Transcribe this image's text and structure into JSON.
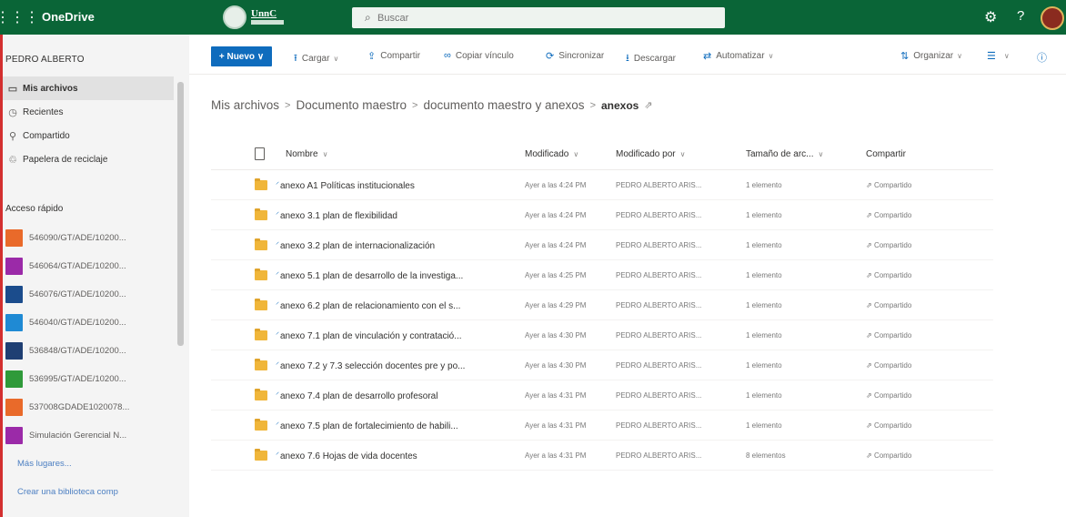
{
  "suite": {
    "app_name": "OneDrive",
    "org_logo_text": "UnnC",
    "search_placeholder": "Buscar"
  },
  "nav": {
    "user": "PEDRO ALBERTO",
    "items": [
      {
        "label": "Mis archivos",
        "icon": "folder-icon",
        "selected": true
      },
      {
        "label": "Recientes",
        "icon": "clock-icon",
        "selected": false
      },
      {
        "label": "Compartido",
        "icon": "people-icon",
        "selected": false
      },
      {
        "label": "Papelera de reciclaje",
        "icon": "recycle-bin-icon",
        "selected": false
      }
    ],
    "quick_access_title": "Acceso rápido",
    "quick_access": [
      {
        "label": "546090/GT/ADE/10200...",
        "color": "#e96a2a"
      },
      {
        "label": "546064/GT/ADE/10200...",
        "color": "#9b2aa8"
      },
      {
        "label": "546076/GT/ADE/10200...",
        "color": "#1b4c8c"
      },
      {
        "label": "546040/GT/ADE/10200...",
        "color": "#1f8ad4"
      },
      {
        "label": "536848/GT/ADE/10200...",
        "color": "#1f3f73"
      },
      {
        "label": "536995/GT/ADE/10200...",
        "color": "#2f9a3a"
      },
      {
        "label": "537008GDADE1020078...",
        "color": "#e96a2a"
      },
      {
        "label": "Simulación Gerencial N...",
        "color": "#9b2aa8"
      }
    ],
    "more_places": "Más lugares...",
    "create_library": "Crear una biblioteca comp"
  },
  "commands": {
    "new": "+ Nuevo ∨",
    "upload": "Cargar",
    "share": "Compartir",
    "copy_link": "Copiar vínculo",
    "sync": "Sincronizar",
    "download": "Descargar",
    "automate": "Automatizar",
    "organize": "Organizar"
  },
  "breadcrumb": {
    "parts": [
      "Mis archivos",
      "Documento maestro",
      "documento maestro y anexos"
    ],
    "current": "anexos"
  },
  "columns": {
    "name": "Nombre",
    "modified": "Modificado",
    "modified_by": "Modificado por",
    "size": "Tamaño de arc...",
    "sharing": "Compartir"
  },
  "files": [
    {
      "name": "anexo A1 Políticas institucionales",
      "modified": "Ayer a las 4:24 PM",
      "modified_by": "PEDRO ALBERTO ARIS...",
      "size": "1 elemento",
      "sharing": "Compartido"
    },
    {
      "name": "anexo 3.1 plan de flexibilidad",
      "modified": "Ayer a las 4:24 PM",
      "modified_by": "PEDRO ALBERTO ARIS...",
      "size": "1 elemento",
      "sharing": "Compartido"
    },
    {
      "name": "anexo 3.2 plan de internacionalización",
      "modified": "Ayer a las 4:24 PM",
      "modified_by": "PEDRO ALBERTO ARIS...",
      "size": "1 elemento",
      "sharing": "Compartido"
    },
    {
      "name": "anexo 5.1 plan de desarrollo de la investiga...",
      "modified": "Ayer a las 4:25 PM",
      "modified_by": "PEDRO ALBERTO ARIS...",
      "size": "1 elemento",
      "sharing": "Compartido"
    },
    {
      "name": "anexo 6.2 plan de relacionamiento con el s...",
      "modified": "Ayer a las 4:29 PM",
      "modified_by": "PEDRO ALBERTO ARIS...",
      "size": "1 elemento",
      "sharing": "Compartido"
    },
    {
      "name": "anexo 7.1 plan de vinculación y contratació...",
      "modified": "Ayer a las 4:30 PM",
      "modified_by": "PEDRO ALBERTO ARIS...",
      "size": "1 elemento",
      "sharing": "Compartido"
    },
    {
      "name": "anexo 7.2 y 7.3 selección docentes pre y po...",
      "modified": "Ayer a las 4:30 PM",
      "modified_by": "PEDRO ALBERTO ARIS...",
      "size": "1 elemento",
      "sharing": "Compartido"
    },
    {
      "name": "anexo 7.4 plan de desarrollo profesoral",
      "modified": "Ayer a las 4:31 PM",
      "modified_by": "PEDRO ALBERTO ARIS...",
      "size": "1 elemento",
      "sharing": "Compartido"
    },
    {
      "name": "anexo 7.5 plan de fortalecimiento de habili...",
      "modified": "Ayer a las 4:31 PM",
      "modified_by": "PEDRO ALBERTO ARIS...",
      "size": "1 elemento",
      "sharing": "Compartido"
    },
    {
      "name": "anexo 7.6 Hojas de vida docentes",
      "modified": "Ayer a las 4:31 PM",
      "modified_by": "PEDRO ALBERTO ARIS...",
      "size": "8 elementos",
      "sharing": "Compartido"
    }
  ]
}
